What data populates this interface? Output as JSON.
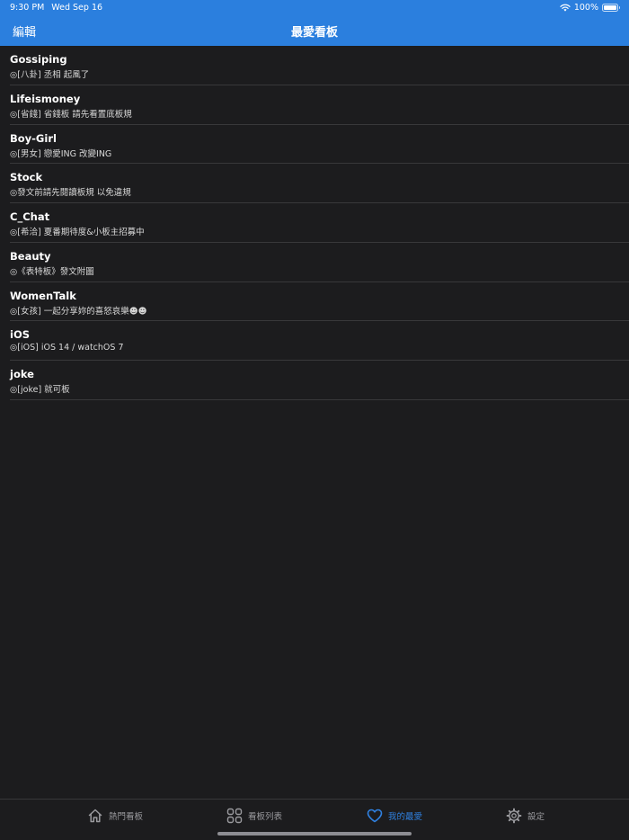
{
  "status_bar": {
    "time": "9:30 PM",
    "date": "Wed Sep 16",
    "battery": "100%",
    "battery_level": 1.0,
    "icons": [
      "wifi-icon",
      "battery-icon"
    ]
  },
  "nav": {
    "edit_label": "編輯",
    "title": "最愛看板"
  },
  "boards": [
    {
      "name": "Gossiping",
      "description": "◎[八卦] 丞相 起風了"
    },
    {
      "name": "Lifeismoney",
      "description": "◎[省錢] 省錢板 請先看置底板規"
    },
    {
      "name": "Boy-Girl",
      "description": "◎[男女] 戀愛ING 改變ING"
    },
    {
      "name": "Stock",
      "description": "◎發文前請先閱讀板規 以免違規"
    },
    {
      "name": "C_Chat",
      "description": "◎[希洽] 夏番期待度&小板主招募中"
    },
    {
      "name": "Beauty",
      "description": "◎《表特板》發文附圖"
    },
    {
      "name": "WomenTalk",
      "description": "◎[女孩] 一起分享妳的喜怒哀樂☻☻"
    },
    {
      "name": "iOS",
      "description": "◎[iOS] iOS 14 / watchOS 7"
    },
    {
      "name": "joke",
      "description": "◎[joke] 就可板"
    }
  ],
  "tabs": [
    {
      "label": "熱門看板",
      "icon": "home-icon",
      "active": false
    },
    {
      "label": "看板列表",
      "icon": "grid-icon",
      "active": false
    },
    {
      "label": "我的最愛",
      "icon": "heart-icon",
      "active": true
    },
    {
      "label": "設定",
      "icon": "gear-icon",
      "active": false
    }
  ],
  "colors": {
    "nav_background": "#2b7fde",
    "background": "#1c1c1e",
    "separator": "#38383a",
    "tab_active": "#2f80e0",
    "tab_inactive": "#9a9a9e"
  }
}
